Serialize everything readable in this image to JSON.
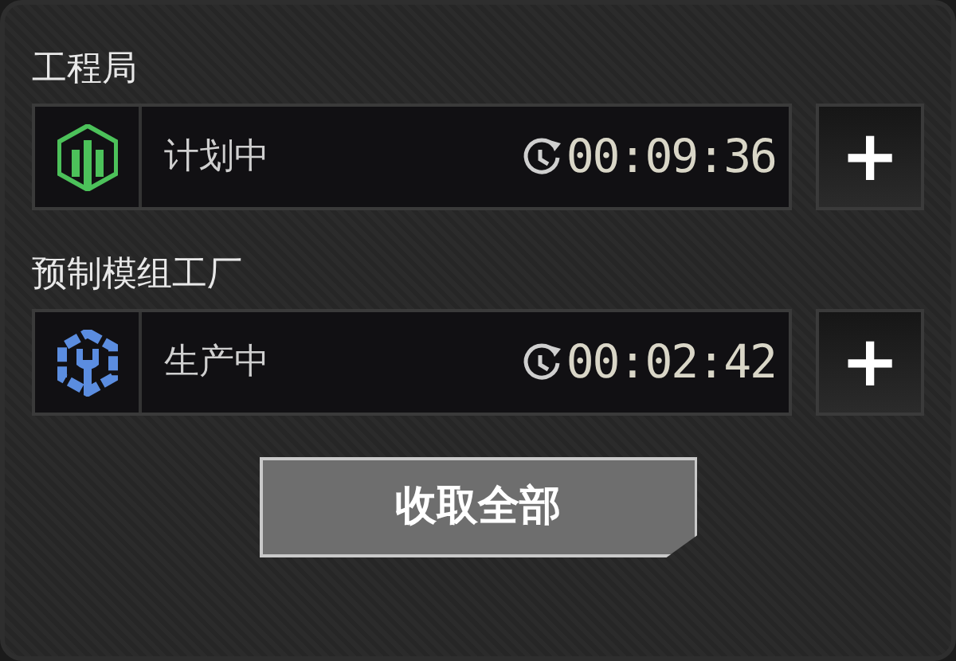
{
  "sections": [
    {
      "title": "工程局",
      "kind": "building",
      "color": "#4cc15a",
      "status": "计划中",
      "timer": "00:09:36",
      "action": "+"
    },
    {
      "title": "预制模组工厂",
      "kind": "gear",
      "color": "#5b8de0",
      "status": "生产中",
      "timer": "00:02:42",
      "action": "+"
    }
  ],
  "collect_button": "收取全部"
}
